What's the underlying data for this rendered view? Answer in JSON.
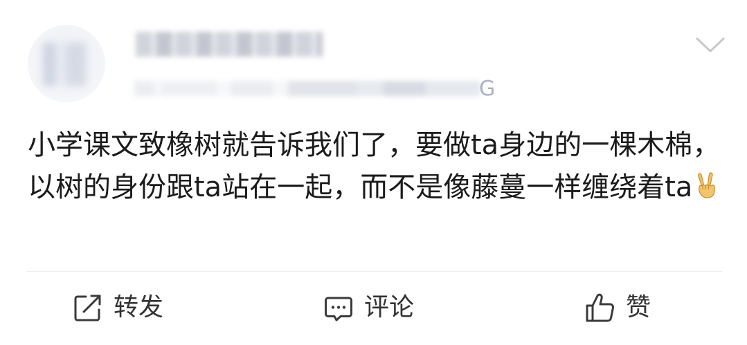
{
  "post": {
    "author_name": "",
    "meta_visible_tail": "G",
    "text": "小学课文致橡树就告诉我们了，要做ta身边的一棵木棉，以树的身份跟ta站在一起，而不是像藤蔓一样缠绕着ta",
    "emoji": "victory-hand-emoji"
  },
  "actions": {
    "repost_label": "转发",
    "comment_label": "评论",
    "like_label": "赞"
  },
  "icons": {
    "menu": "chevron-down-icon",
    "repost": "share-arrow-icon",
    "comment": "comment-bubble-icon",
    "like": "thumbs-up-icon"
  },
  "colors": {
    "text": "#1b1b1b",
    "icon": "#3a3a3a",
    "divider": "#ececec",
    "chevron": "#c8c8c8",
    "emoji": "#f2c46b"
  }
}
